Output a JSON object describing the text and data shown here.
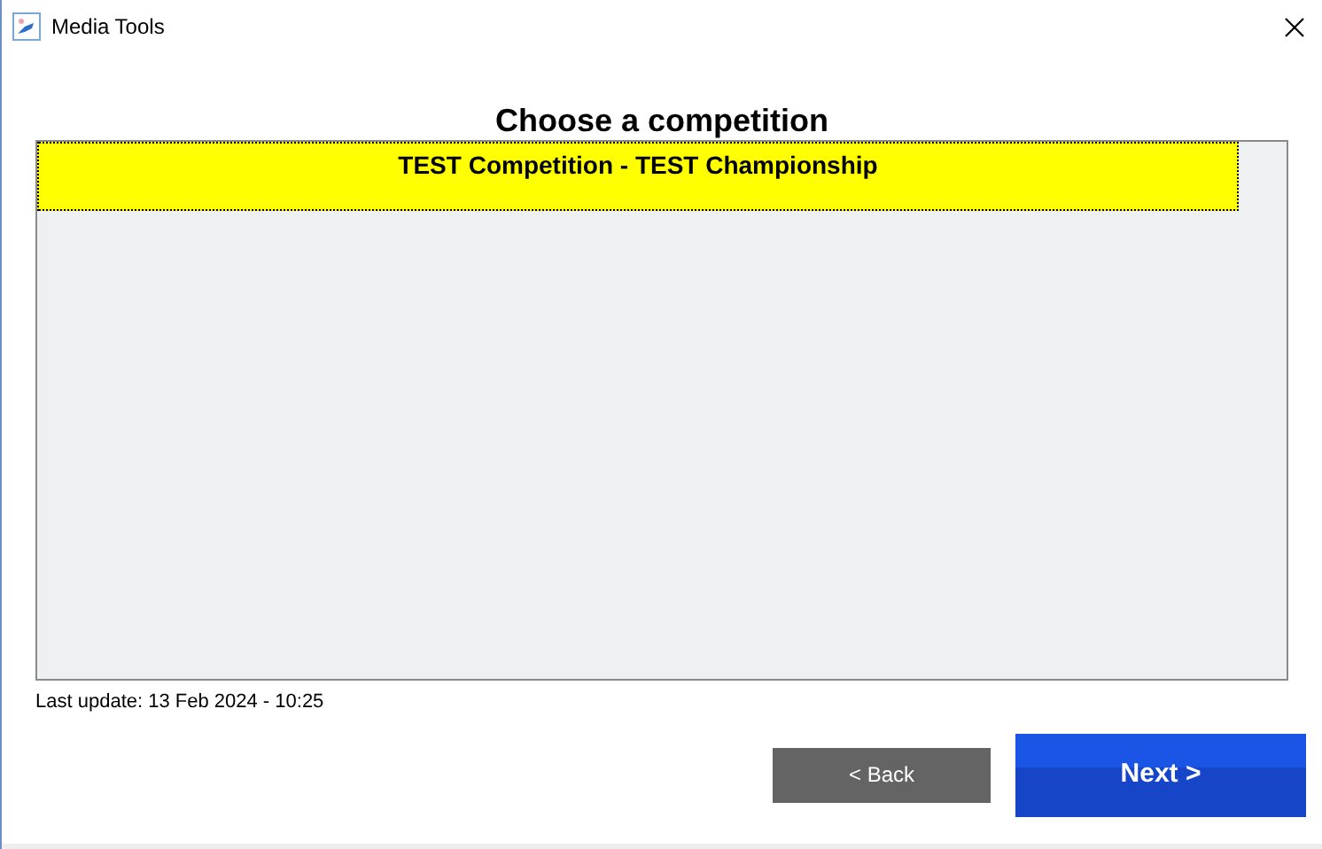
{
  "window": {
    "title": "Media Tools"
  },
  "heading": "Choose a competition",
  "competitions": [
    {
      "label": "TEST Competition - TEST Championship",
      "selected": true
    }
  ],
  "last_update": "Last update: 13 Feb 2024 - 10:25",
  "buttons": [
    {
      "label": "< Back",
      "kind": "secondary"
    },
    {
      "label": "Next >",
      "kind": "primary"
    }
  ]
}
